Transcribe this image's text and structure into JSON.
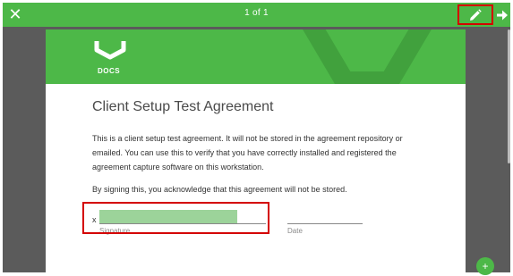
{
  "toolbar": {
    "close_icon": "close-icon",
    "page_counter": "1 of 1",
    "edit_icon": "pencil-icon",
    "next_icon": "arrow-right-icon"
  },
  "header": {
    "logo_icon": "docs-logo-icon",
    "logo_label": "DOCS"
  },
  "agreement": {
    "title": "Client Setup Test Agreement",
    "paragraph": "This is a client setup test agreement. It will not be stored in the agreement repository or emailed. You can use this to verify that you have correctly installed and registered the agreement capture software on this workstation.",
    "acknowledgement": "By signing this, you acknowledge that this agreement will not be stored.",
    "signature_mark": "x",
    "signature_label": "Signature",
    "date_label": "Date"
  },
  "fab": {
    "label": "+"
  },
  "colors": {
    "brand_green": "#4db848",
    "signature_fill": "#9cd39a",
    "highlight_red": "#d40000",
    "viewer_background": "#5b5b5b"
  }
}
